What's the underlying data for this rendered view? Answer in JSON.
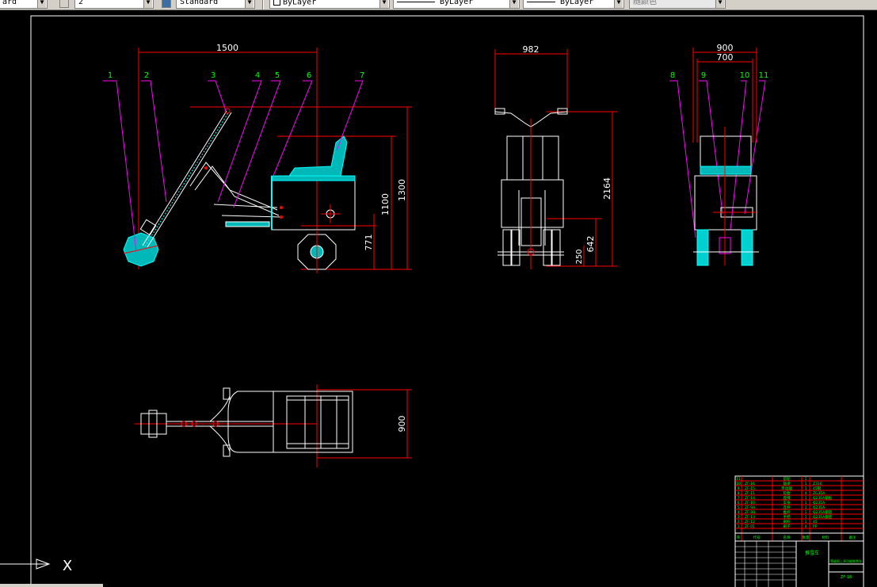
{
  "toolbar": {
    "textstyle_value": "ard",
    "dimscale_value": "2",
    "dimstyle_value": "Standard",
    "layer_value": "ByLayer",
    "linetype_value": "ByLayer",
    "lineweight_value": "ByLayer",
    "color_value": "随颜色"
  },
  "colors": {
    "background": "#000000",
    "white": "#ffffff",
    "red": "#ff0000",
    "green": "#00ff00",
    "cyan": "#00ffff",
    "magenta": "#ff00ff"
  },
  "drawing": {
    "dims": {
      "side_width": "1500",
      "side_h1100": "1100",
      "side_h1300": "1300",
      "side_h771": "771",
      "front_width": "982",
      "front_h2164": "2164",
      "front_h642": "642",
      "front_h250": "250",
      "rear_w900": "900",
      "rear_w700": "700",
      "top_w900": "900"
    },
    "balloons": [
      "1",
      "2",
      "3",
      "4",
      "5",
      "6",
      "7",
      "8",
      "9",
      "10",
      "11"
    ]
  },
  "title_block": {
    "title": "推雪车",
    "subtitle": "等级图上多功能推雪车",
    "drawing_no": "ZF-18",
    "col_seq": "序",
    "col_code": "代号",
    "col_name": "名称",
    "col_qty": "数量",
    "col_material": "材料",
    "col_note": "备注",
    "rows": [
      {
        "no": "11",
        "code": "",
        "name": "前轮",
        "qty": "1",
        "mat": ""
      },
      {
        "no": "10",
        "code": "ZF-16",
        "name": "轴承",
        "qty": "1",
        "mat": "Z316"
      },
      {
        "no": "9",
        "code": "ZF-15",
        "name": "传动轴",
        "qty": "1",
        "mat": "45钢"
      },
      {
        "no": "8",
        "code": "ZF-11",
        "name": "轮胎",
        "qty": "4",
        "mat": "ZG35A"
      },
      {
        "no": "7",
        "code": "ZF-14",
        "name": "座椅",
        "qty": "1",
        "mat": "Q235A钢板"
      },
      {
        "no": "6",
        "code": "ZF-10",
        "name": "车身",
        "qty": "1",
        "mat": "Q235A"
      },
      {
        "no": "5",
        "code": "ZF-9A",
        "name": "连杆",
        "qty": "1",
        "mat": "Q235A"
      },
      {
        "no": "4",
        "code": "ZF-8B",
        "name": "推杆",
        "qty": "1",
        "mat": "Q235A钢管"
      },
      {
        "no": "3",
        "code": "ZF-13",
        "name": "手把",
        "qty": "1",
        "mat": "Q235A钢管"
      },
      {
        "no": "2",
        "code": "ZF-12",
        "name": "刷杆",
        "qty": "1",
        "mat": "45"
      },
      {
        "no": "1",
        "code": "ZF-01",
        "name": "刷子",
        "qty": "4",
        "mat": "PP"
      }
    ],
    "total": "合 计"
  },
  "ucs": {
    "x_label": "X"
  }
}
